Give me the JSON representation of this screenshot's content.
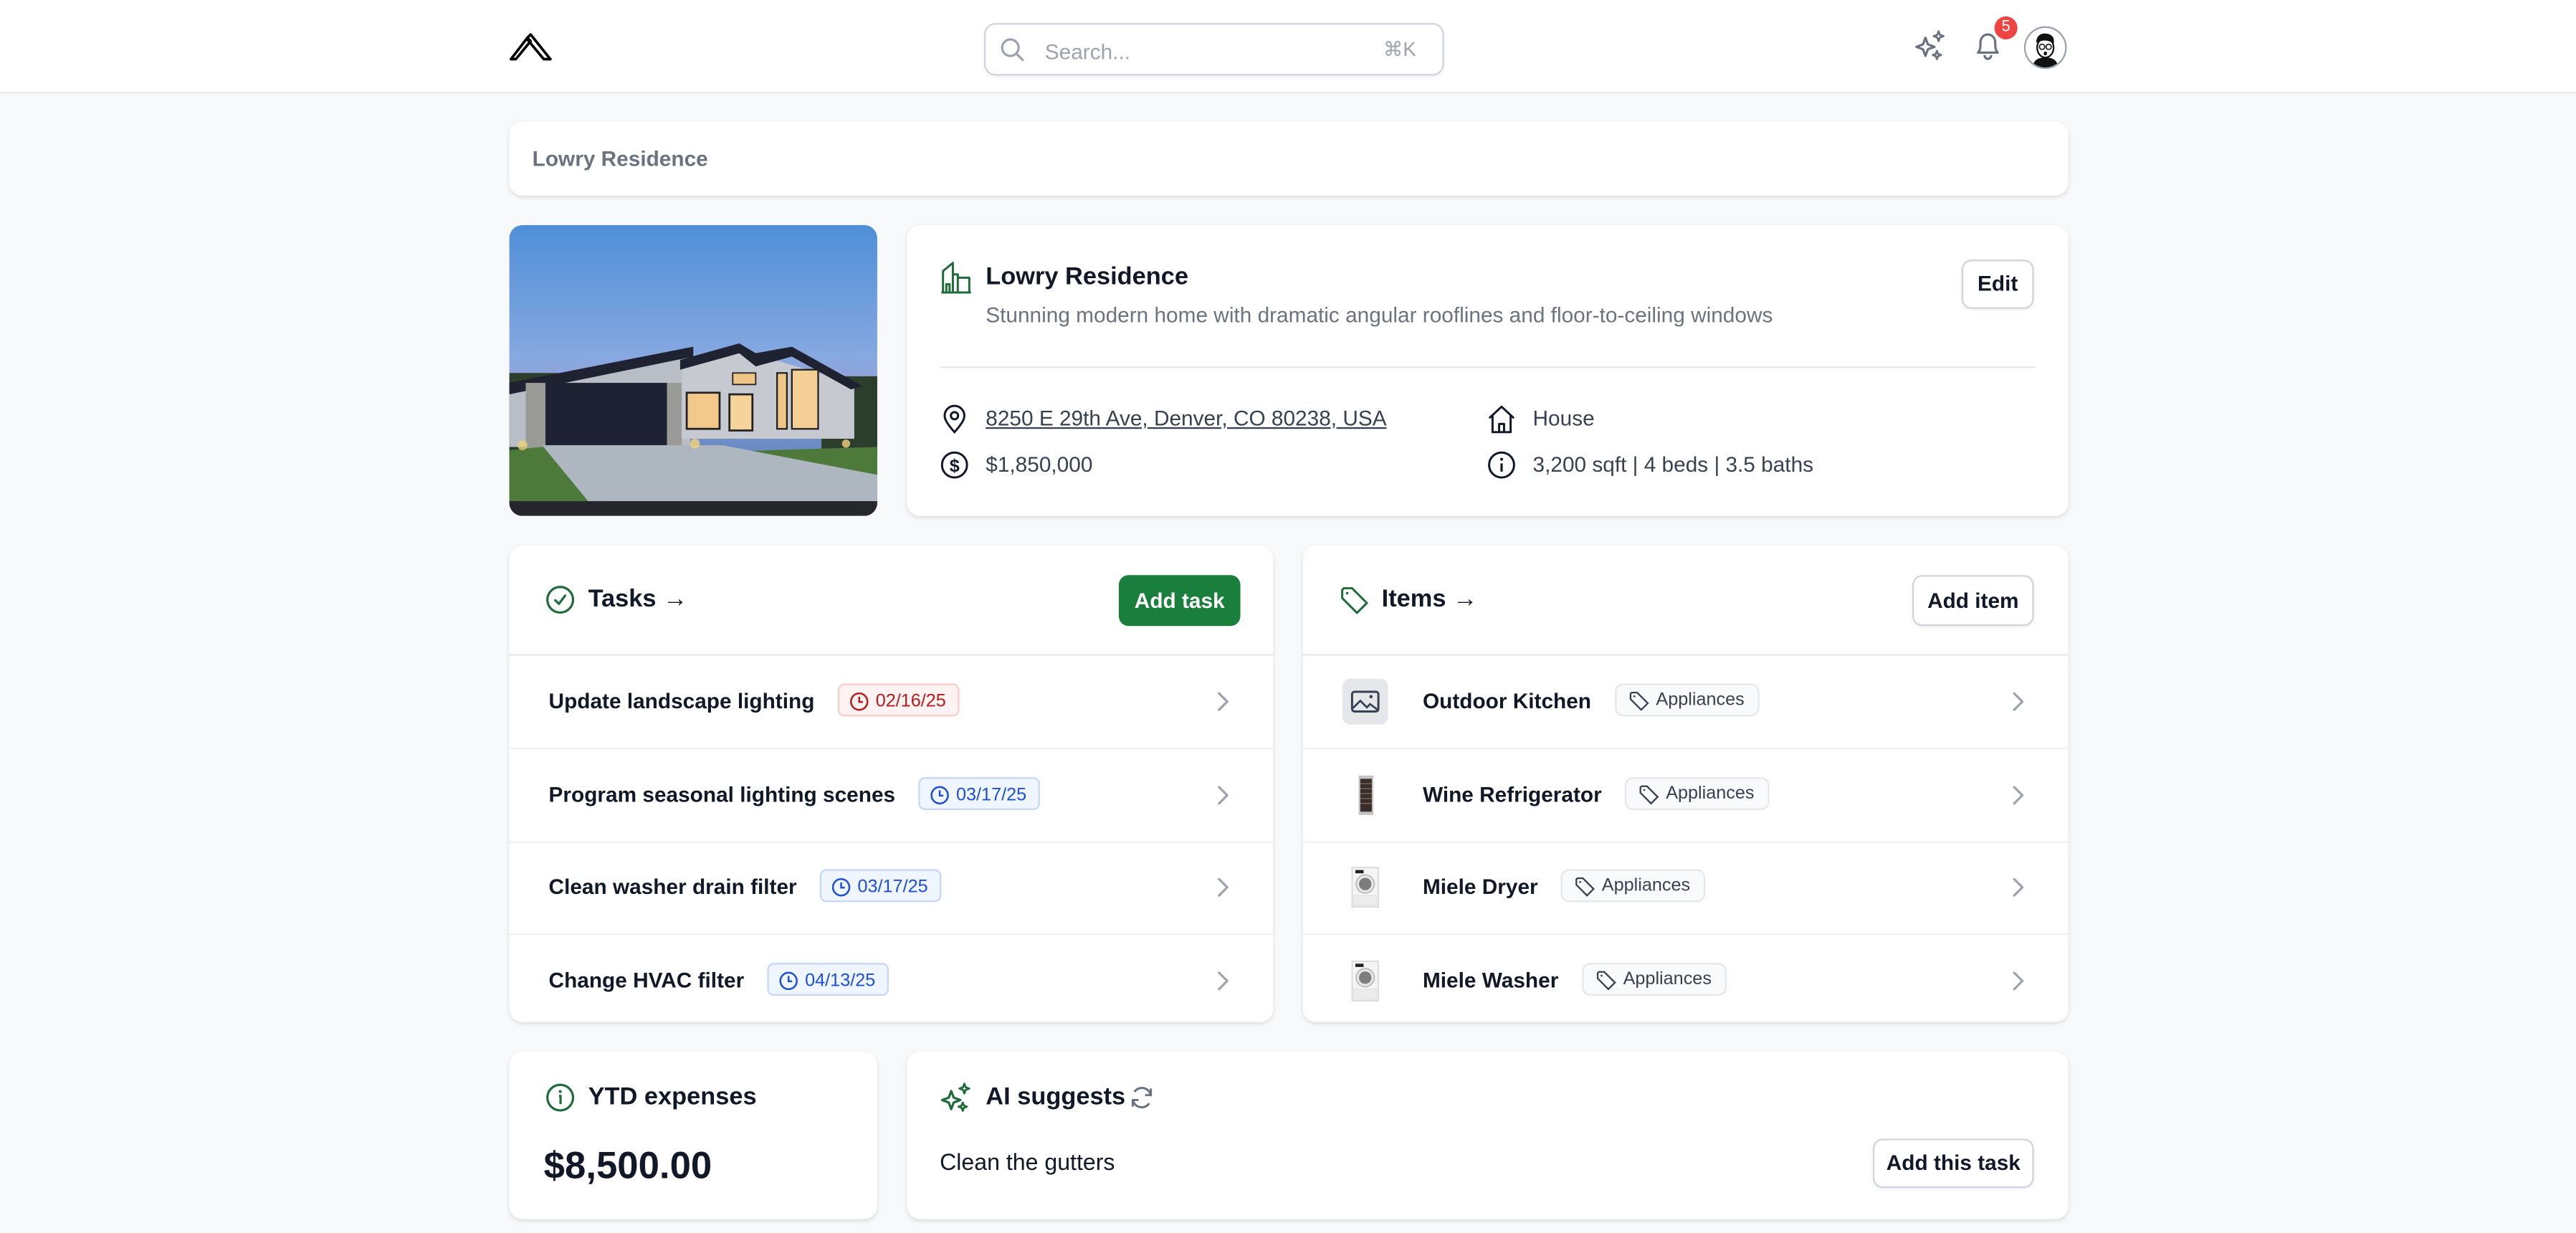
{
  "header": {
    "logo": "mountain-logo",
    "search": {
      "placeholder": "Search...",
      "value": "",
      "shortcut": "⌘K"
    },
    "notifications_count": "5",
    "icons": [
      "sparkles-icon",
      "bell-icon",
      "avatar"
    ]
  },
  "breadcrumb": {
    "current": "Lowry Residence"
  },
  "property": {
    "name": "Lowry Residence",
    "description": "Stunning modern home with dramatic angular rooflines and floor-to-ceiling windows",
    "edit_label": "Edit",
    "address": "8250 E 29th Ave, Denver, CO 80238, USA",
    "price": "$1,850,000",
    "type": "House",
    "details": "3,200 sqft | 4 beds | 3.5 baths"
  },
  "tasks": {
    "title": "Tasks →",
    "add_label": "Add task",
    "rows": [
      {
        "name": "Update landscape lighting",
        "date": "02/16/25",
        "status": "overdue"
      },
      {
        "name": "Program seasonal lighting scenes",
        "date": "03/17/25",
        "status": "upcoming"
      },
      {
        "name": "Clean washer drain filter",
        "date": "03/17/25",
        "status": "upcoming"
      },
      {
        "name": "Change HVAC filter",
        "date": "04/13/25",
        "status": "upcoming"
      }
    ]
  },
  "items": {
    "title": "Items →",
    "add_label": "Add item",
    "rows": [
      {
        "name": "Outdoor Kitchen",
        "category": "Appliances",
        "thumb": "image-placeholder-icon"
      },
      {
        "name": "Wine Refrigerator",
        "category": "Appliances",
        "thumb": "wine-fridge-photo"
      },
      {
        "name": "Miele Dryer",
        "category": "Appliances",
        "thumb": "dryer-photo"
      },
      {
        "name": "Miele Washer",
        "category": "Appliances",
        "thumb": "washer-photo"
      }
    ]
  },
  "ytd": {
    "title": "YTD expenses",
    "value": "$8,500.00"
  },
  "ai": {
    "title": "AI suggests",
    "suggestion": "Clean the gutters",
    "add_label": "Add this task"
  },
  "colors": {
    "brand_green": "#1a7f3c",
    "icon_green": "#1f6b3a",
    "overdue_red": "#b91c1c",
    "upcoming_blue": "#1d4ed8",
    "badge_red": "#ef4444"
  }
}
